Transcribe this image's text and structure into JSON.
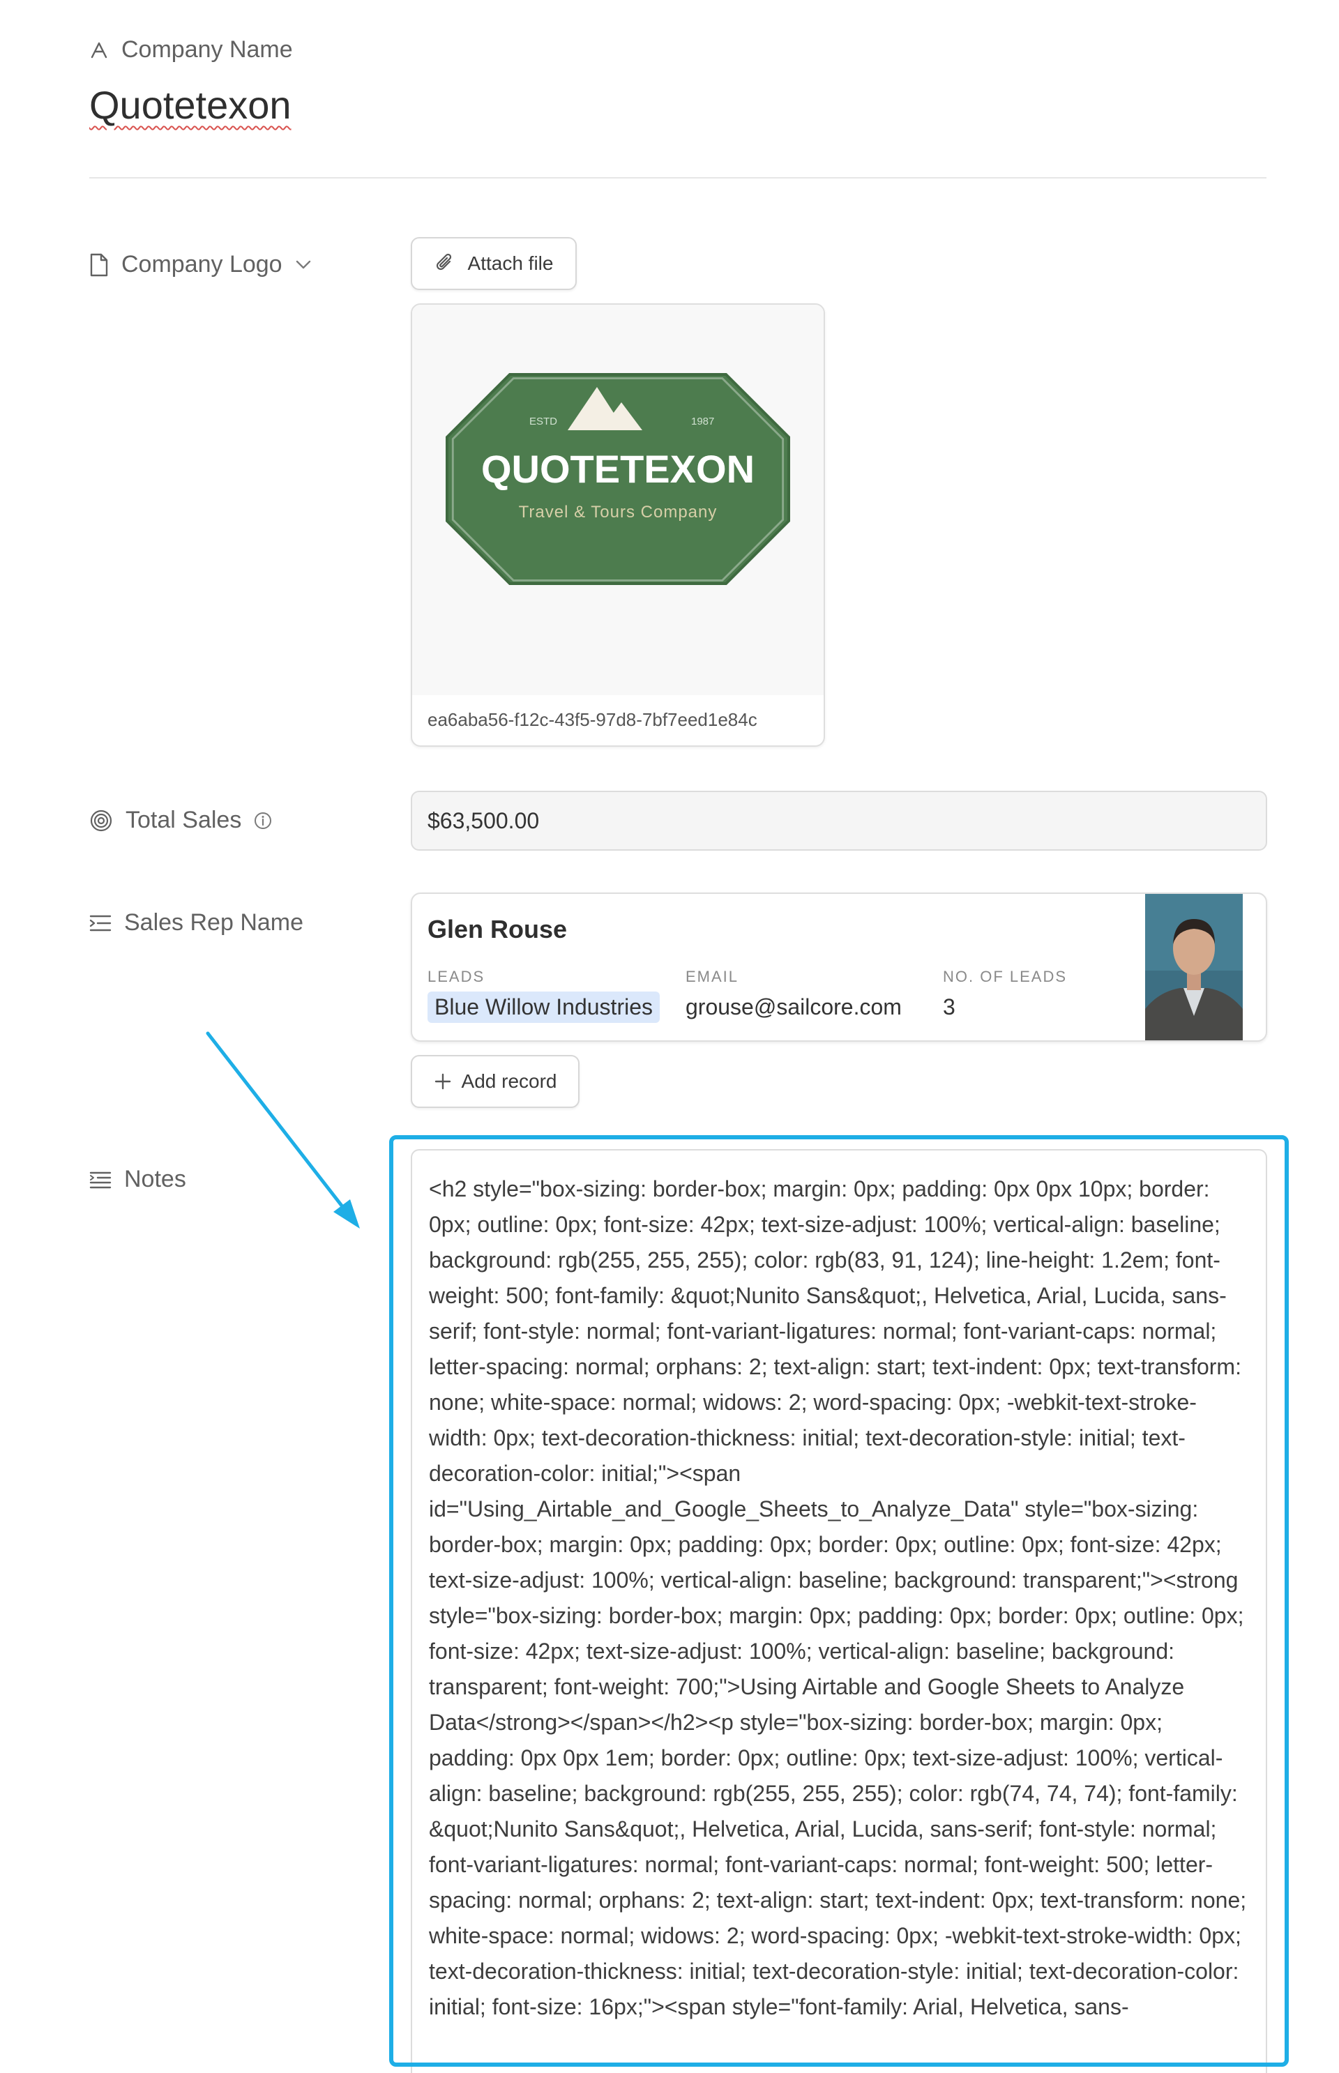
{
  "header": {
    "field_label": "Company Name",
    "title": "Quotetexon"
  },
  "company_logo": {
    "label": "Company Logo",
    "attach_button": "Attach file",
    "filename": "ea6aba56-f12c-43f5-97d8-7bf7eed1e84c",
    "logo": {
      "brand": "QUOTETEXON",
      "tagline": "Travel & Tours Company",
      "estd_label": "ESTD",
      "year": "1987",
      "badge_color": "#4d7c4e",
      "mountain_color": "#f4efe4"
    }
  },
  "total_sales": {
    "label": "Total Sales",
    "value": "$63,500.00"
  },
  "sales_rep": {
    "label": "Sales Rep Name",
    "name": "Glen Rouse",
    "columns": {
      "leads": "LEADS",
      "email": "EMAIL",
      "count": "NO. OF LEADS"
    },
    "lead": "Blue Willow Industries",
    "email": "grouse@sailcore.com",
    "lead_count": "3",
    "add_record_button": "Add record"
  },
  "notes": {
    "label": "Notes",
    "text": "<h2 style=\"box-sizing: border-box; margin: 0px; padding: 0px 0px 10px; border: 0px; outline: 0px; font-size: 42px; text-size-adjust: 100%; vertical-align: baseline; background: rgb(255, 255, 255); color: rgb(83, 91, 124); line-height: 1.2em; font-weight: 500; font-family: &quot;Nunito Sans&quot;, Helvetica, Arial, Lucida, sans-serif; font-style: normal; font-variant-ligatures: normal; font-variant-caps: normal; letter-spacing: normal; orphans: 2; text-align: start; text-indent: 0px; text-transform: none; white-space: normal; widows: 2; word-spacing: 0px; -webkit-text-stroke-width: 0px; text-decoration-thickness: initial; text-decoration-style: initial; text-decoration-color: initial;\"><span id=\"Using_Airtable_and_Google_Sheets_to_Analyze_Data\" style=\"box-sizing: border-box; margin: 0px; padding: 0px; border: 0px; outline: 0px; font-size: 42px; text-size-adjust: 100%; vertical-align: baseline; background: transparent;\"><strong style=\"box-sizing: border-box; margin: 0px; padding: 0px; border: 0px; outline: 0px; font-size: 42px; text-size-adjust: 100%; vertical-align: baseline; background: transparent; font-weight: 700;\">Using Airtable and Google Sheets to Analyze Data</strong></span></h2><p style=\"box-sizing: border-box; margin: 0px; padding: 0px 0px 1em; border: 0px; outline: 0px; text-size-adjust: 100%; vertical-align: baseline; background: rgb(255, 255, 255); color: rgb(74, 74, 74); font-family: &quot;Nunito Sans&quot;, Helvetica, Arial, Lucida, sans-serif; font-style: normal; font-variant-ligatures: normal; font-variant-caps: normal; font-weight: 500; letter-spacing: normal; orphans: 2; text-align: start; text-indent: 0px; text-transform: none; white-space: normal; widows: 2; word-spacing: 0px; -webkit-text-stroke-width: 0px; text-decoration-thickness: initial; text-decoration-style: initial; text-decoration-color: initial; font-size: 16px;\"><span style=\"font-family: Arial, Helvetica, sans-"
  }
}
